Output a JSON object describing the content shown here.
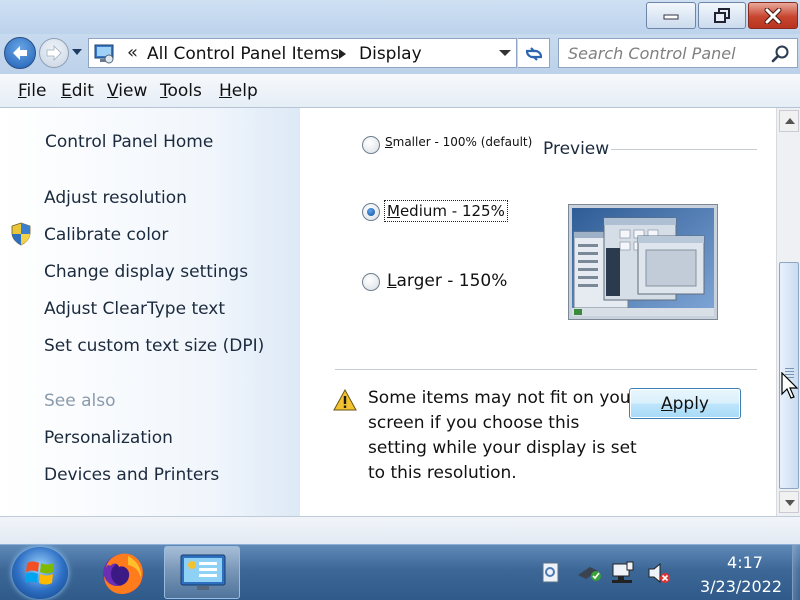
{
  "address": {
    "chevron": "«",
    "crumbs": [
      "All Control Panel Items",
      "Display"
    ]
  },
  "search": {
    "placeholder": "Search Control Panel"
  },
  "menu": {
    "file": {
      "mnemonic": "F",
      "rest": "ile"
    },
    "edit": {
      "mnemonic": "E",
      "rest": "dit"
    },
    "view": {
      "mnemonic": "V",
      "rest": "iew"
    },
    "tools": {
      "mnemonic": "T",
      "rest": "ools"
    },
    "help": {
      "mnemonic": "H",
      "rest": "elp"
    }
  },
  "nav": {
    "home": "Control Panel Home",
    "items": [
      "Adjust resolution",
      "Calibrate color",
      "Change display settings",
      "Adjust ClearType text",
      "Set custom text size (DPI)"
    ],
    "see_also_heading": "See also",
    "see_also": [
      "Personalization",
      "Devices and Printers"
    ]
  },
  "options": {
    "smaller": {
      "mnemonic": "S",
      "rest": "maller - 100% (default)"
    },
    "medium": {
      "mnemonic": "M",
      "rest": "edium - 125%"
    },
    "larger": {
      "mnemonic": "L",
      "rest": "arger - 150%"
    },
    "selected": "medium"
  },
  "preview": {
    "label": "Preview"
  },
  "warning": {
    "text": "Some items may not fit on your screen if you choose this setting while your display is set to this resolution."
  },
  "apply_button": {
    "mnemonic": "A",
    "rest": "pply"
  },
  "taskbar": {
    "time": "4:17",
    "date": "3/23/2022"
  },
  "icons": {
    "back": "back-arrow-icon",
    "forward": "forward-arrow-icon",
    "refresh": "refresh-icon",
    "search": "search-icon",
    "shield": "uac-shield-icon",
    "warning": "warning-triangle-icon",
    "start": "windows-logo-icon",
    "firefox": "firefox-icon",
    "control_panel": "control-panel-icon",
    "volume": "volume-muted-icon"
  },
  "colors": {
    "accent": "#1d5fb4",
    "close": "#c8452f",
    "taskbar": "#3c6797"
  }
}
